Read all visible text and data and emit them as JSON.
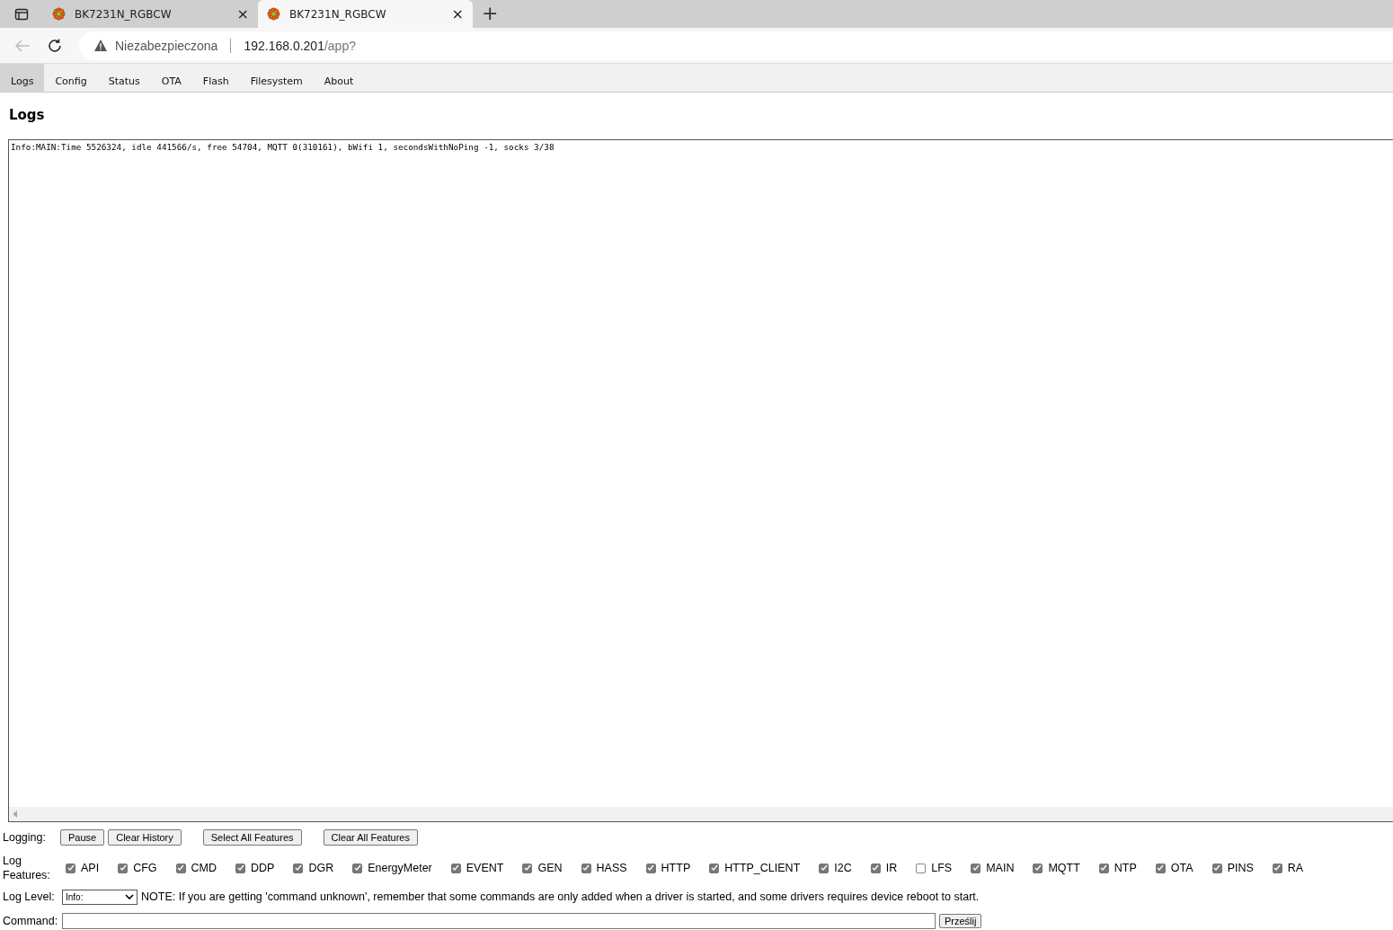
{
  "browser_tabs": [
    {
      "title": "BK7231N_RGBCW",
      "selected": false,
      "close": "×"
    },
    {
      "title": "BK7231N_RGBCW",
      "selected": true,
      "close": "×"
    }
  ],
  "new_tab": "+",
  "address_bar": {
    "security": "Niezabezpieczona",
    "host": "192.168.0.201",
    "path": "/app?"
  },
  "tabs": [
    {
      "label": "Logs",
      "selected": true
    },
    {
      "label": "Config",
      "selected": false
    },
    {
      "label": "Status",
      "selected": false
    },
    {
      "label": "OTA",
      "selected": false
    },
    {
      "label": "Flash",
      "selected": false
    },
    {
      "label": "Filesystem",
      "selected": false
    },
    {
      "label": "About",
      "selected": false
    }
  ],
  "heading": "Logs",
  "log_lines": [
    "Info:MAIN:Time 5526324, idle 441566/s, free 54704, MQTT 0(310161), bWifi 1, secondsWithNoPing -1, socks 3/38"
  ],
  "logging": {
    "label": "Logging:",
    "buttons": [
      "Pause",
      "Clear History",
      "Select All Features",
      "Clear All Features"
    ]
  },
  "features": {
    "label": "Log Features:",
    "items": [
      {
        "label": "API",
        "checked": true
      },
      {
        "label": "CFG",
        "checked": true
      },
      {
        "label": "CMD",
        "checked": true
      },
      {
        "label": "DDP",
        "checked": true
      },
      {
        "label": "DGR",
        "checked": true
      },
      {
        "label": "EnergyMeter",
        "checked": true
      },
      {
        "label": "EVENT",
        "checked": true
      },
      {
        "label": "GEN",
        "checked": true
      },
      {
        "label": "HASS",
        "checked": true
      },
      {
        "label": "HTTP",
        "checked": true
      },
      {
        "label": "HTTP_CLIENT",
        "checked": true
      },
      {
        "label": "I2C",
        "checked": true
      },
      {
        "label": "IR",
        "checked": true
      },
      {
        "label": "LFS",
        "checked": false
      },
      {
        "label": "MAIN",
        "checked": true
      },
      {
        "label": "MQTT",
        "checked": true
      },
      {
        "label": "NTP",
        "checked": true
      },
      {
        "label": "OTA",
        "checked": true
      },
      {
        "label": "PINS",
        "checked": true
      },
      {
        "label": "RA",
        "checked": true
      }
    ]
  },
  "log_level": {
    "label": "Log Level:",
    "value": "Info:",
    "note": "NOTE: If you are getting 'command unknown', remember that some commands are only added when a driver is started, and some drivers requires device reboot to start."
  },
  "command": {
    "label": "Command:",
    "submit": "Prześlij"
  }
}
